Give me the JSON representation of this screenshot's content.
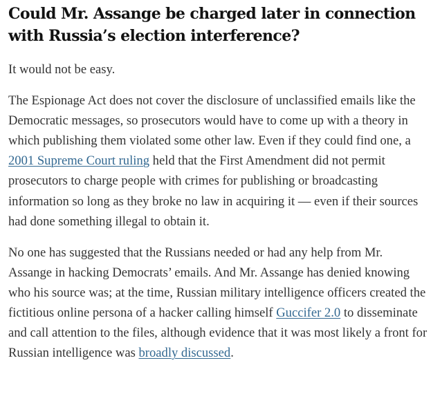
{
  "article": {
    "headline": "Could Mr. Assange be charged later in connection with Russia’s election interference?",
    "paragraphs": [
      {
        "text": "It would not be easy."
      },
      {
        "before_link": "The Espionage Act does not cover the disclosure of unclassified emails like the Democratic messages, so prosecutors would have to come up with a theory in which publishing them violated some other law. Even if they could find one, a ",
        "link_text": "2001 Supreme Court ruling",
        "after_link": " held that the First Amendment did not permit prosecutors to charge people with crimes for publishing or broadcasting information so long as they broke no law in acquiring it — even if their sources had done something illegal to obtain it."
      },
      {
        "before_link1": "No one has suggested that the Russians needed or had any help from Mr. Assange in hacking Democrats’ emails. And Mr. Assange has denied knowing who his source was; at the time, Russian military intelligence officers created the fictitious online persona of a hacker calling himself ",
        "link1_text": "Guccifer 2.0",
        "between_links": " to disseminate and call attention to the files, although evidence that it was most likely a front for Russian intelligence was ",
        "link2_text": "broadly discussed",
        "after_link2": "."
      }
    ]
  },
  "colors": {
    "headline": "#121212",
    "body_text": "#333333",
    "link": "#326891",
    "background": "#ffffff"
  }
}
